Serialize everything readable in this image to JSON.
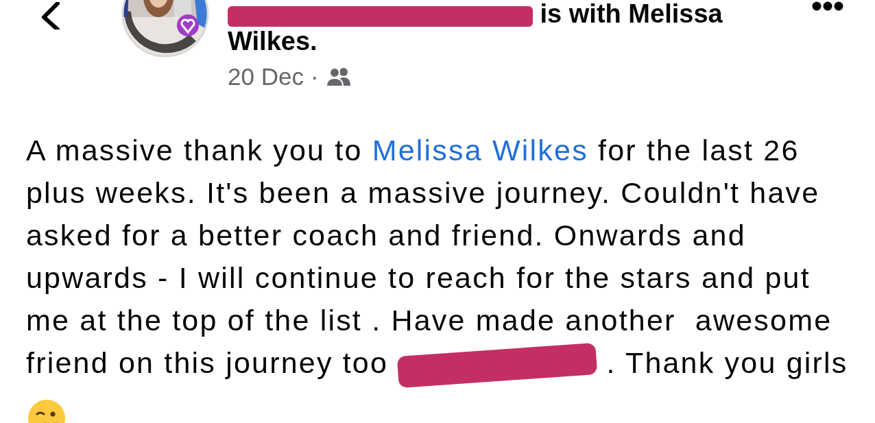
{
  "post": {
    "author_line": [
      {
        "kind": "redacted"
      },
      {
        "kind": "text",
        "text": " is with Melissa Wilkes."
      }
    ],
    "date": "20 Dec",
    "separator": "·",
    "body": [
      {
        "kind": "text",
        "text": "A massive thank you to "
      },
      {
        "kind": "mention",
        "text": "Melissa Wilkes"
      },
      {
        "kind": "text",
        "text": " for the last 26 plus weeks. It's been a massive journey. Couldn't have asked for a better coach and friend. Onwards and upwards - I will continue to reach for the stars and put me at the top of the list . Have made another  awesome friend on this journey too "
      },
      {
        "kind": "redacted"
      },
      {
        "kind": "text",
        "text": " . Thank you girls"
      }
    ]
  }
}
